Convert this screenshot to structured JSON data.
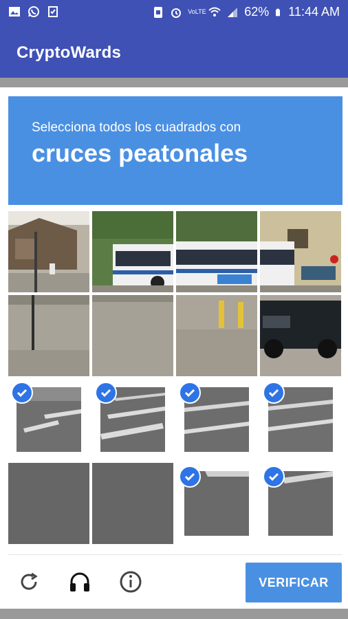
{
  "statusbar": {
    "battery": "62%",
    "time": "11:44 AM",
    "network_label": "VoLTE",
    "icons": [
      "image-icon",
      "whatsapp-icon",
      "clipboard-icon",
      "sim-icon",
      "alarm-icon",
      "volte-icon",
      "wifi-icon",
      "signal-icon",
      "battery-icon"
    ]
  },
  "app": {
    "title": "CryptoWards"
  },
  "challenge": {
    "instruction": "Selecciona todos los cuadrados con",
    "target": "cruces peatonales",
    "tiles": [
      {
        "row": 0,
        "col": 0,
        "selected": false,
        "scene": "house-with-pole"
      },
      {
        "row": 0,
        "col": 1,
        "selected": false,
        "scene": "bus-front"
      },
      {
        "row": 0,
        "col": 2,
        "selected": false,
        "scene": "bus-middle"
      },
      {
        "row": 0,
        "col": 3,
        "selected": false,
        "scene": "bus-rear-building"
      },
      {
        "row": 1,
        "col": 0,
        "selected": false,
        "scene": "parking-lot-pole"
      },
      {
        "row": 1,
        "col": 1,
        "selected": false,
        "scene": "parking-lot"
      },
      {
        "row": 1,
        "col": 2,
        "selected": false,
        "scene": "curb-bollard"
      },
      {
        "row": 1,
        "col": 3,
        "selected": false,
        "scene": "black-suv"
      },
      {
        "row": 2,
        "col": 0,
        "selected": true,
        "scene": "crosswalk"
      },
      {
        "row": 2,
        "col": 1,
        "selected": true,
        "scene": "crosswalk"
      },
      {
        "row": 2,
        "col": 2,
        "selected": true,
        "scene": "crosswalk"
      },
      {
        "row": 2,
        "col": 3,
        "selected": true,
        "scene": "crosswalk"
      },
      {
        "row": 3,
        "col": 0,
        "selected": false,
        "scene": "asphalt"
      },
      {
        "row": 3,
        "col": 1,
        "selected": false,
        "scene": "asphalt"
      },
      {
        "row": 3,
        "col": 2,
        "selected": true,
        "scene": "crosswalk"
      },
      {
        "row": 3,
        "col": 3,
        "selected": true,
        "scene": "crosswalk"
      }
    ]
  },
  "footer": {
    "icons": [
      "reload-icon",
      "audio-headphones-icon",
      "info-icon"
    ],
    "verify_label": "VERIFICAR"
  },
  "colors": {
    "appbar": "#3F51B5",
    "prompt_bg": "#4A90E2",
    "check": "#2E74E6",
    "verify_bg": "#4A90E2"
  }
}
